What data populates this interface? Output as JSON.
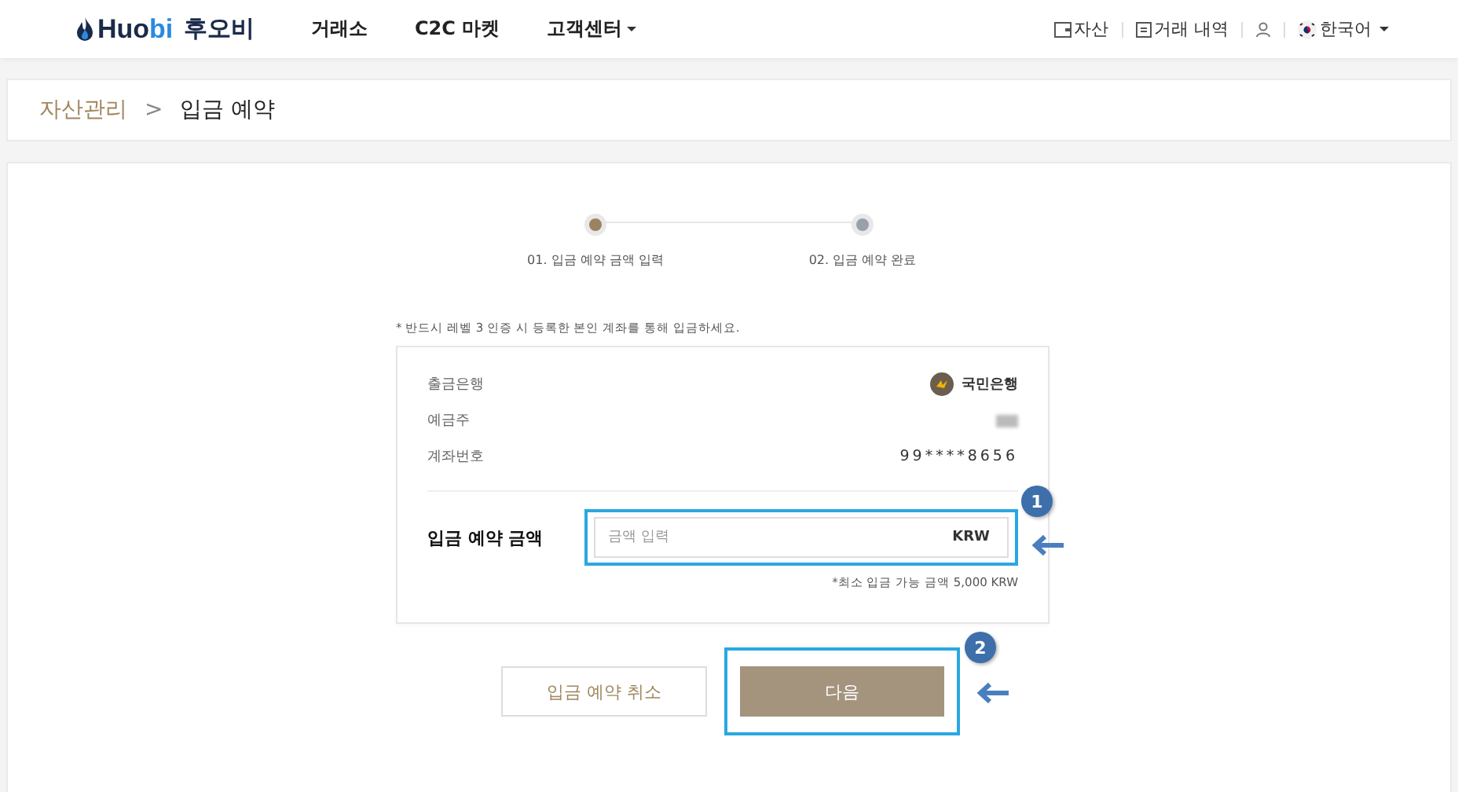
{
  "header": {
    "logo": {
      "brand": "Huo",
      "brand_accent": "bi",
      "local": "후오비"
    },
    "nav": [
      {
        "label": "거래소",
        "dropdown": false
      },
      {
        "label": "C2C 마켓",
        "dropdown": false
      },
      {
        "label": "고객센터",
        "dropdown": true
      }
    ],
    "assets_link": "자산",
    "history_link": "거래 내역",
    "language": "한국어"
  },
  "breadcrumb": {
    "parent": "자산관리",
    "separator": ">",
    "current": "입금 예약"
  },
  "steps": [
    {
      "label": "01. 입금 예약 금액 입력",
      "active": true
    },
    {
      "label": "02. 입금 예약 완료",
      "active": false
    }
  ],
  "notice": "* 반드시 레벨 3 인증 시 등록한 본인 계좌를 통해 입금하세요.",
  "account": {
    "bank_label": "출금은행",
    "bank_name": "국민은행",
    "holder_label": "예금주",
    "number_label": "계좌번호",
    "number": "99****8656"
  },
  "amount": {
    "label": "입금 예약 금액",
    "placeholder": "금액 입력",
    "currency": "KRW",
    "min_note": "*최소 입금 가능 금액 5,000 KRW"
  },
  "buttons": {
    "cancel": "입금 예약 취소",
    "next": "다음"
  },
  "callouts": [
    "1",
    "2"
  ]
}
